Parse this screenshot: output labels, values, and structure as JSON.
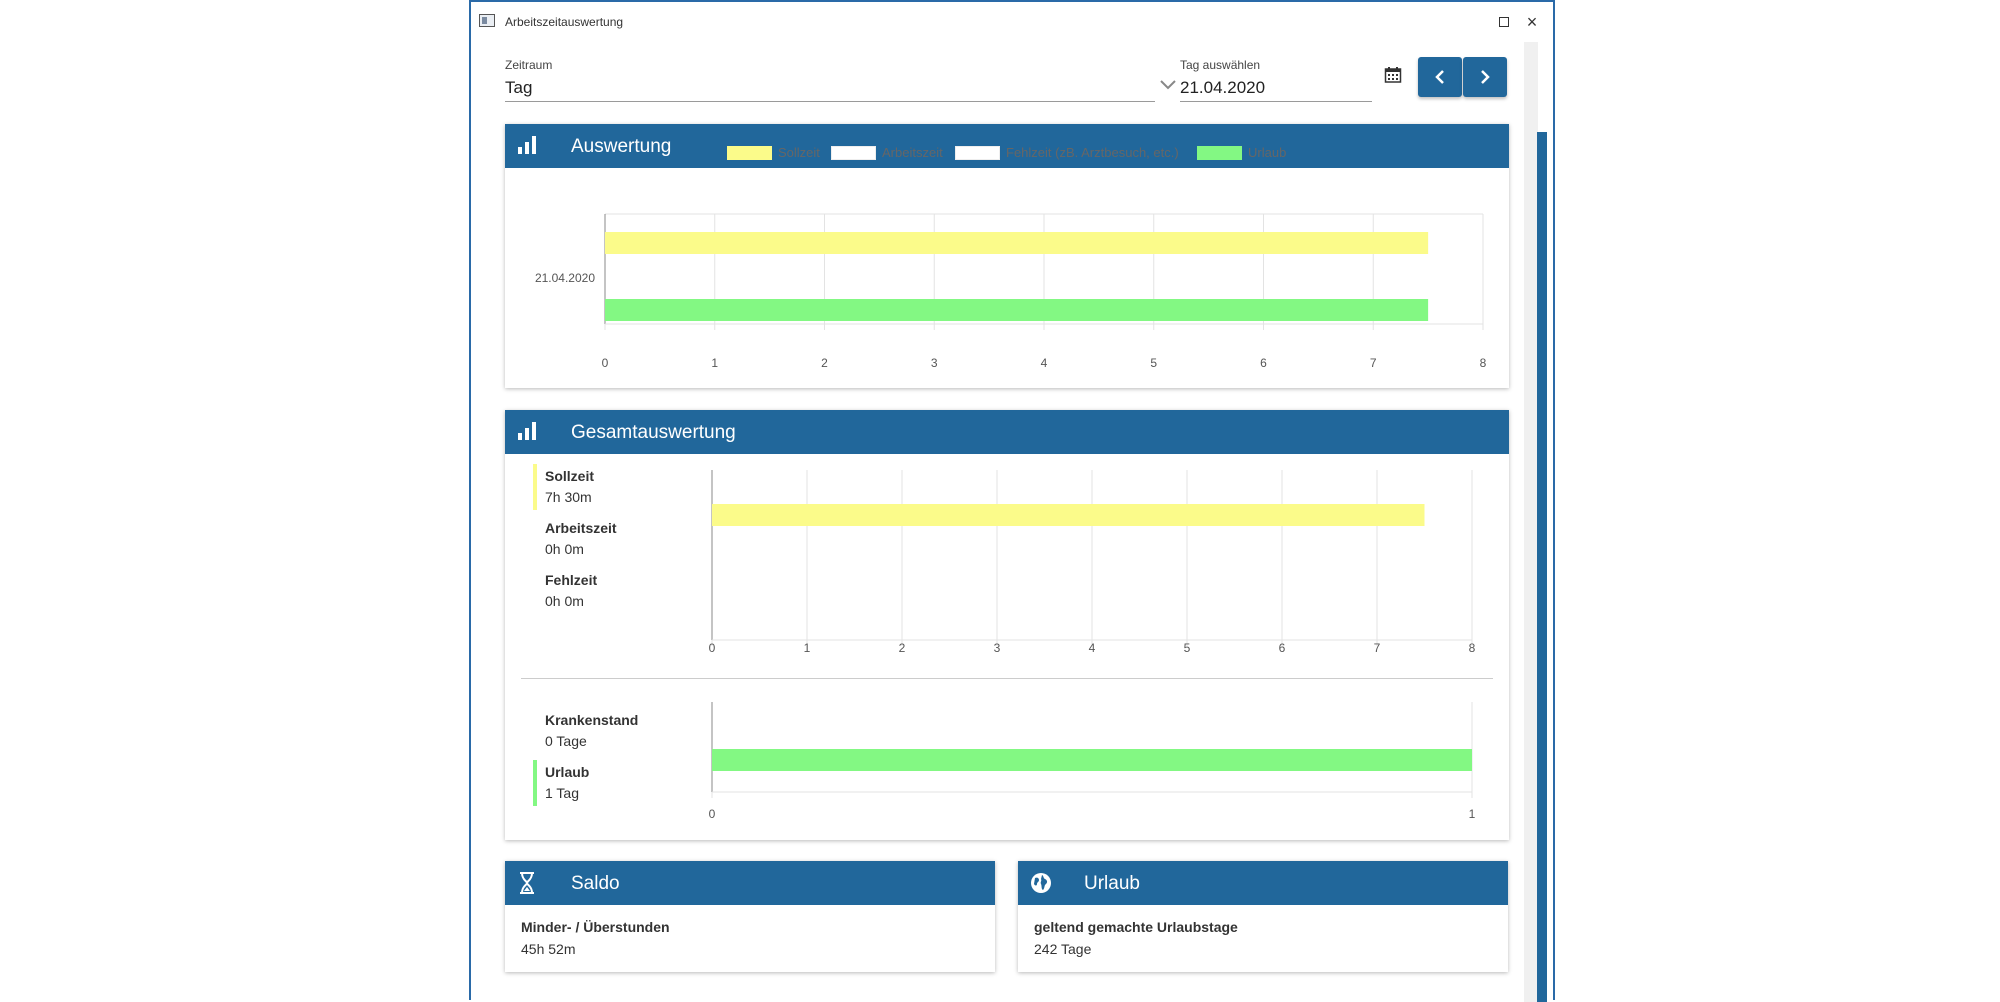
{
  "window": {
    "title": "Arbeitszeitauswertung",
    "maximize_label": "maximize",
    "close_label": "×"
  },
  "filters": {
    "zeitraum_label": "Zeitraum",
    "zeitraum_value": "Tag",
    "tag_label": "Tag auswählen",
    "tag_value": "21.04.2020"
  },
  "auswertung": {
    "title": "Auswertung",
    "legend": [
      {
        "label": "Sollzeit",
        "color": "#fbfb8a"
      },
      {
        "label": "Arbeitszeit",
        "color": "#ffffff"
      },
      {
        "label": "Fehlzeit (zB. Arztbesuch, etc.)",
        "color": "#ffffff"
      },
      {
        "label": "Urlaub",
        "color": "#83f883"
      }
    ]
  },
  "gesamtauswertung": {
    "title": "Gesamtauswertung",
    "stats": [
      {
        "label": "Sollzeit",
        "value": "7h 30m",
        "marker_color": "#fbfb8a"
      },
      {
        "label": "Arbeitszeit",
        "value": "0h 0m"
      },
      {
        "label": "Fehlzeit",
        "value": "0h 0m"
      }
    ],
    "days_stats": [
      {
        "label": "Krankenstand",
        "value": "0 Tage"
      },
      {
        "label": "Urlaub",
        "value": "1 Tag",
        "marker_color": "#83f883"
      }
    ]
  },
  "saldo": {
    "title": "Saldo",
    "label": "Minder- / Überstunden",
    "value": "45h 52m"
  },
  "urlaub": {
    "title": "Urlaub",
    "label": "geltend gemachte Urlaubstage",
    "value": "242 Tage"
  },
  "chart_data": [
    {
      "type": "bar",
      "orientation": "horizontal",
      "categories": [
        "21.04.2020"
      ],
      "series": [
        {
          "name": "Sollzeit",
          "values": [
            7.5
          ],
          "color": "#fbfb8a"
        },
        {
          "name": "Arbeitszeit",
          "values": [
            0
          ],
          "color": "#ffffff"
        },
        {
          "name": "Fehlzeit (zB. Arztbesuch, etc.)",
          "values": [
            0
          ],
          "color": "#ffffff"
        },
        {
          "name": "Urlaub",
          "values": [
            7.5
          ],
          "color": "#83f883"
        }
      ],
      "xlim": [
        0,
        8
      ],
      "xticks": [
        "0",
        "1",
        "2",
        "3",
        "4",
        "5",
        "6",
        "7",
        "8"
      ],
      "grid": true,
      "legend_position": "top"
    },
    {
      "type": "bar",
      "orientation": "horizontal",
      "categories": [
        "Sollzeit",
        "Arbeitszeit",
        "Fehlzeit"
      ],
      "values": [
        7.5,
        0,
        0
      ],
      "color": "#fbfb8a",
      "xlim": [
        0,
        8
      ],
      "xticks": [
        "0",
        "1",
        "2",
        "3",
        "4",
        "5",
        "6",
        "7",
        "8"
      ],
      "grid": true
    },
    {
      "type": "bar",
      "orientation": "horizontal",
      "categories": [
        "Krankenstand",
        "Urlaub"
      ],
      "values": [
        0,
        1
      ],
      "color": "#83f883",
      "xlim": [
        0,
        1
      ],
      "xticks": [
        "0",
        "1"
      ],
      "grid": true
    }
  ]
}
